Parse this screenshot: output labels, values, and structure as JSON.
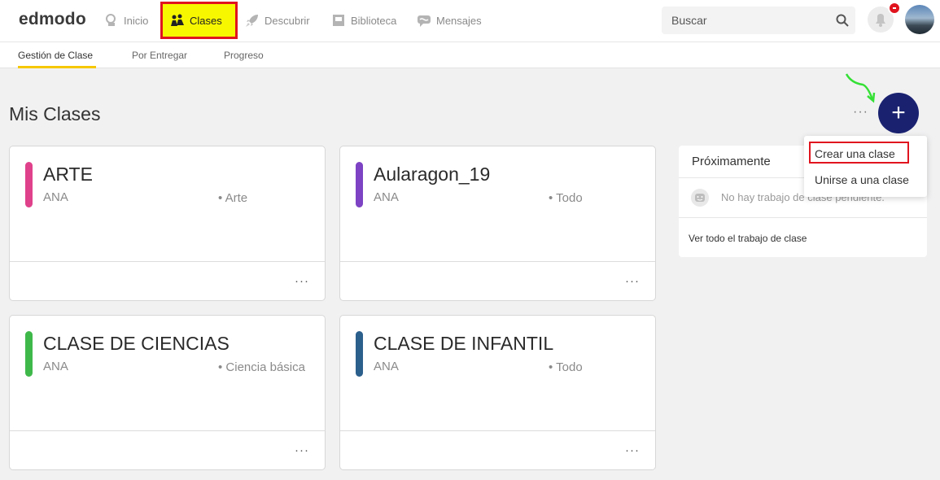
{
  "app": {
    "logo": "edmodo"
  },
  "nav": {
    "inicio": "Inicio",
    "clases": "Clases",
    "descubrir": "Descubrir",
    "biblioteca": "Biblioteca",
    "mensajes": "Mensajes"
  },
  "search": {
    "placeholder": "Buscar",
    "icon": "search-icon"
  },
  "subnav": {
    "gestion": "Gestión de Clase",
    "entregar": "Por Entregar",
    "progreso": "Progreso"
  },
  "main": {
    "title": "Mis Clases",
    "more": "···",
    "fab": "+"
  },
  "classes": [
    {
      "name": "ARTE",
      "owner": "ANA",
      "subject": "• Arte",
      "color": "#e0418b"
    },
    {
      "name": "Aularagon_19",
      "owner": "ANA",
      "subject": "• Todo",
      "color": "#7d43c4"
    },
    {
      "name": "CLASE DE CIENCIAS",
      "owner": "ANA",
      "subject": "• Ciencia básica",
      "color": "#3fb84a"
    },
    {
      "name": "CLASE DE INFANTIL",
      "owner": "ANA",
      "subject": "• Todo",
      "color": "#2b5f8c"
    }
  ],
  "card_menu": "···",
  "upcoming": {
    "title": "Próximamente",
    "empty": "No hay trabajo de clase pendiente.",
    "link": "Ver todo el trabajo de clase"
  },
  "dropdown": {
    "create": "Crear una clase",
    "join": "Unirse a una clase"
  },
  "colors": {
    "accent_fab": "#1a2270",
    "highlight_yellow": "#f7f700",
    "highlight_red": "#e0141e",
    "tab_underline": "#f6c800"
  }
}
